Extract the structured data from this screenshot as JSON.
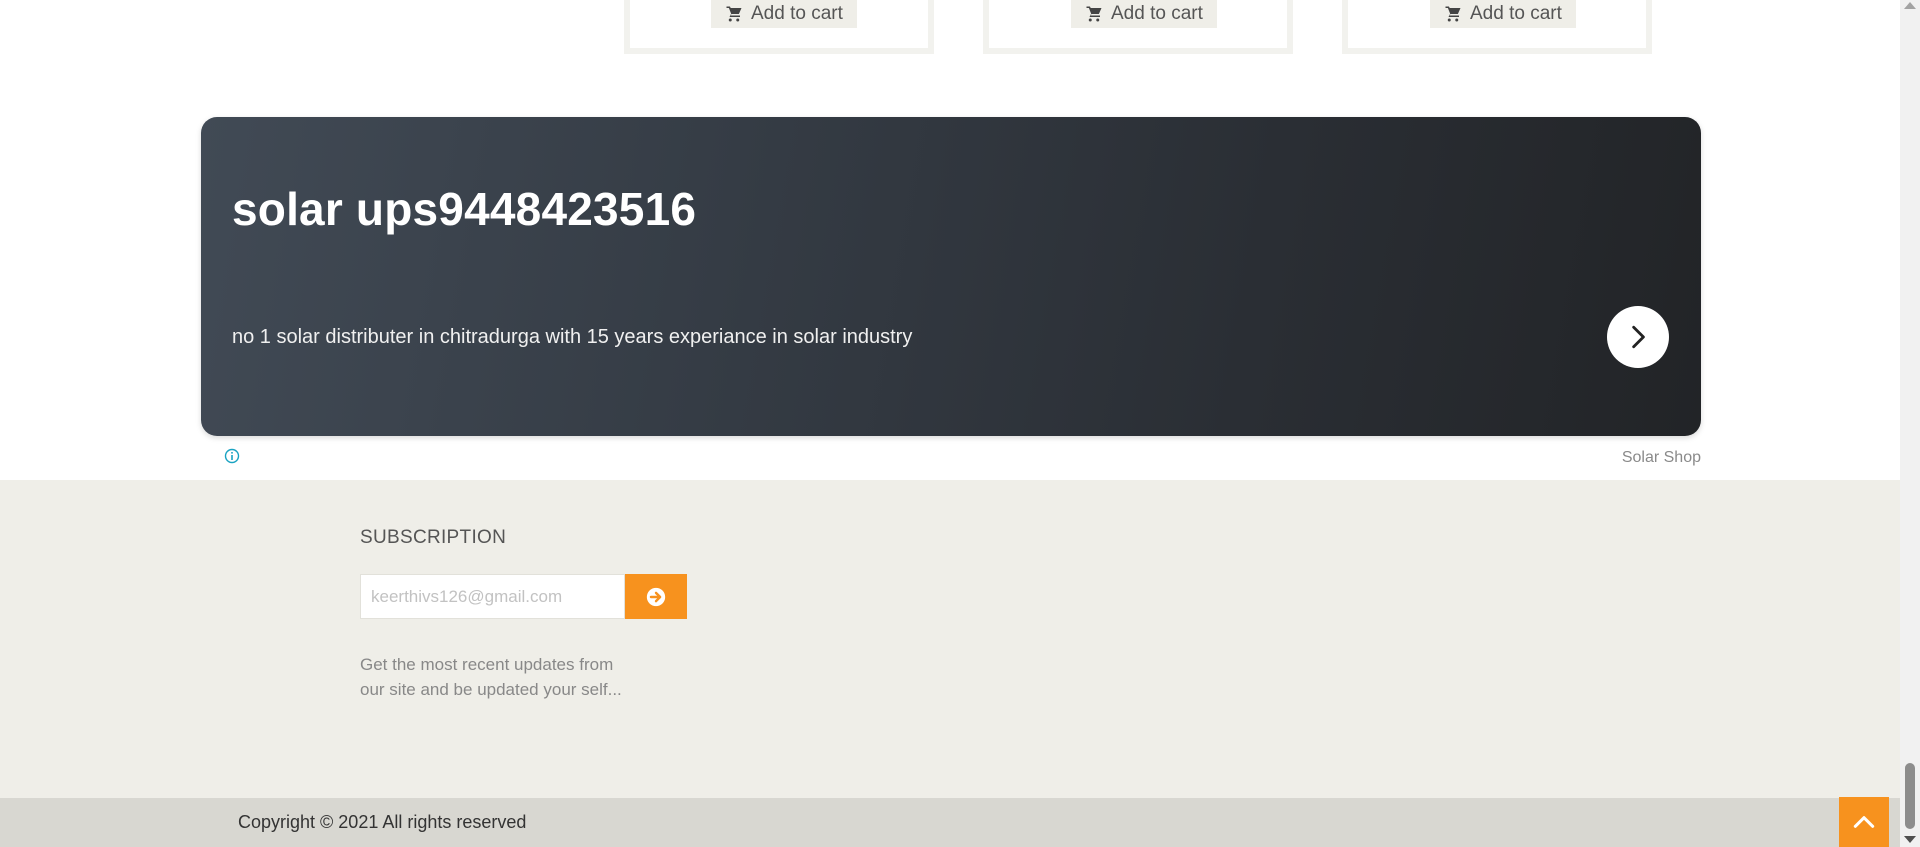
{
  "products": [
    {
      "cart_label": "Add to cart"
    },
    {
      "cart_label": "Add to cart"
    },
    {
      "cart_label": "Add to cart"
    }
  ],
  "ad": {
    "title": "solar ups9448423516",
    "description": "no 1 solar distributer in chitradurga with 15 years experiance in solar industry",
    "source": "Solar Shop",
    "next_icon": "chevron-right-icon",
    "info_icon": "info-icon"
  },
  "subscription": {
    "heading": "SUBSCRIPTION",
    "email_placeholder": "keerthivs126@gmail.com",
    "submit_icon": "arrow-circle-right-icon",
    "description": "Get the most recent updates from our site and be updated your self..."
  },
  "footer": {
    "copyright": "Copyright © 2021 All rights reserved",
    "back_to_top_icon": "chevron-up-icon"
  },
  "colors": {
    "accent": "#f7921e",
    "section_bg": "#efeee8",
    "footer_bg": "#d8d7d1",
    "banner_dark": "#222427"
  }
}
